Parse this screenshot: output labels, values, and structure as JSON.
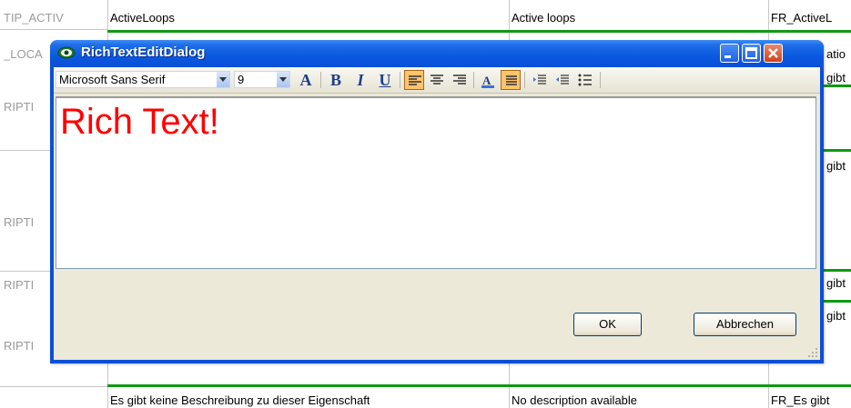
{
  "background": {
    "rows": [
      {
        "key": "TIP_ACTIV",
        "col1": "ActiveLoops",
        "col2": "Active loops",
        "col3": "FR_ActiveL"
      },
      {
        "key": "_LOCA",
        "col1": "",
        "col2": "",
        "col3": "atio"
      },
      {
        "key": "RIPTI",
        "col1": "",
        "col2": "",
        "col3": "gibt"
      },
      {
        "key": "RIPTI",
        "col1": "",
        "col2": "",
        "col3": "gibt"
      },
      {
        "key": "RIPTI",
        "col1": "",
        "col2": "",
        "col3": "gibt"
      },
      {
        "key": "RIPTI",
        "col1": "",
        "col2": "",
        "col3": "gibt"
      },
      {
        "key": "",
        "col1": "Es gibt keine Beschreibung zu dieser Eigenschaft",
        "col2": "No description available",
        "col3": "FR_Es gibt"
      }
    ]
  },
  "dialog": {
    "title": "RichTextEditDialog",
    "toolbar": {
      "font": "Microsoft Sans Serif",
      "size": "9",
      "bold": "B",
      "italic": "I",
      "underline": "U",
      "font_color": "A"
    },
    "editor_text": "Rich Text!",
    "ok_label": "OK",
    "cancel_label": "Abbrechen"
  },
  "colors": {
    "title_bar": "#0a58e0",
    "editor_text": "#ff0000",
    "active_toggle": "#ffc36b",
    "grid_green": "#119911"
  }
}
